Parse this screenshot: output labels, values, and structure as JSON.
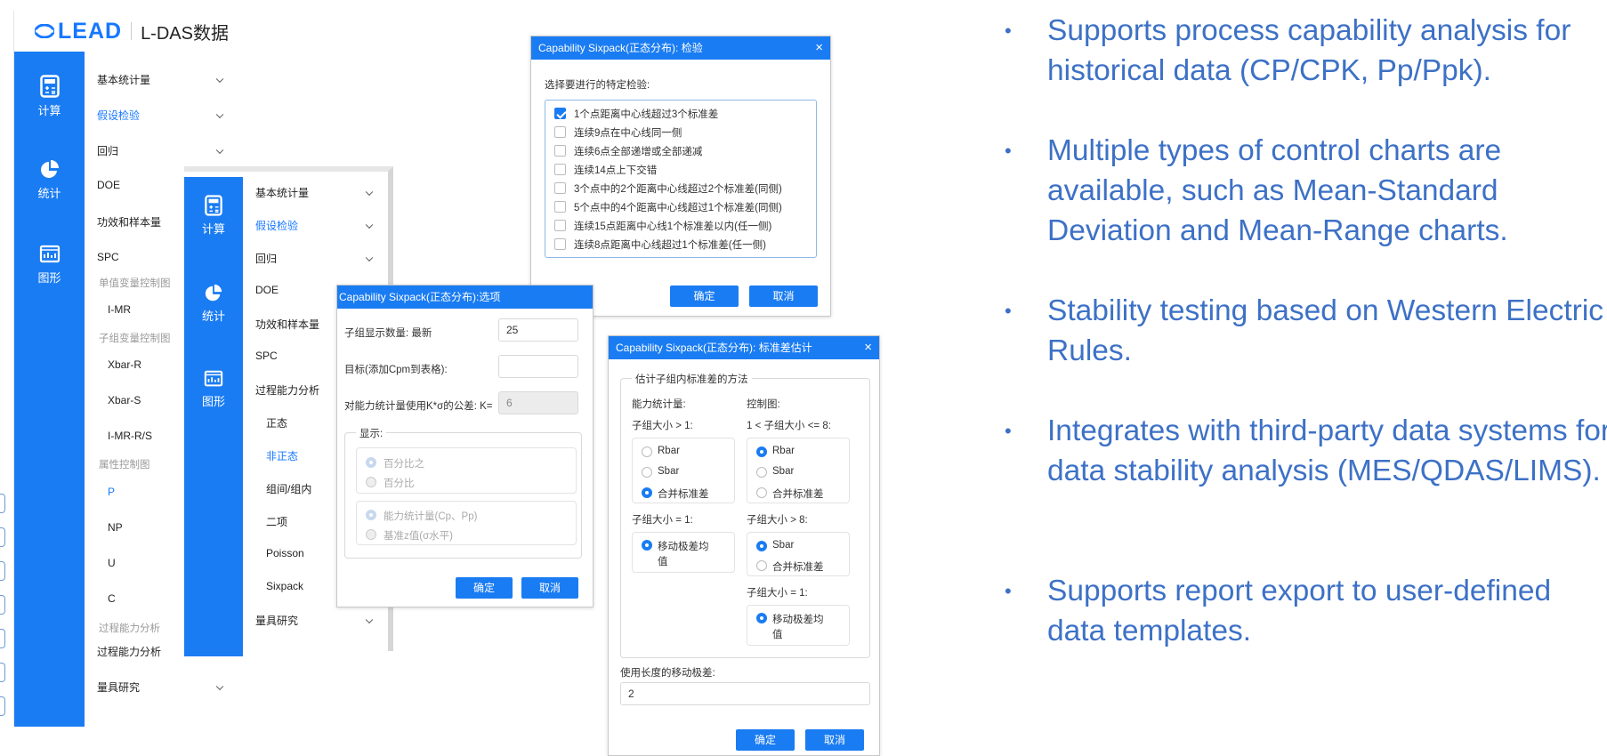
{
  "app": {
    "logo_text": "LEAD",
    "app_name": "L-DAS数据",
    "rail": [
      {
        "label": "计算",
        "icon": "calculator-icon"
      },
      {
        "label": "统计",
        "icon": "pie-chart-icon"
      },
      {
        "label": "图形",
        "icon": "chart-board-icon"
      }
    ],
    "menu1": {
      "basic_stats": "基本统计量",
      "hypothesis": "假设检验",
      "regression": "回归",
      "doe": "DOE",
      "power": "功效和样本量",
      "spc": "SPC",
      "group_single": "单值变量控制图",
      "imr": "I-MR",
      "group_subgroup": "子组变量控制图",
      "xbar_r": "Xbar-R",
      "xbar_s": "Xbar-S",
      "imr_rs": "I-MR-R/S",
      "group_attr": "属性控制图",
      "p": "P",
      "np": "NP",
      "u": "U",
      "c": "C",
      "group_capability": "过程能力分析",
      "capability": "过程能力分析",
      "gauge": "量具研究"
    },
    "menu2": {
      "basic_stats": "基本统计量",
      "hypothesis": "假设检验",
      "regression": "回归",
      "doe": "DOE",
      "power": "功效和样本量",
      "spc": "SPC",
      "capability": "过程能力分析",
      "normal": "正态",
      "nonnormal": "非正态",
      "between_within": "组间/组内",
      "binomial": "二项",
      "poisson": "Poisson",
      "sixpack": "Sixpack",
      "gauge": "量具研究"
    }
  },
  "dialog_tests": {
    "title": "Capability Sixpack(正态分布): 检验",
    "close": "×",
    "prompt": "选择要进行的特定检验:",
    "tests": [
      {
        "label": "1个点距离中心线超过3个标准差",
        "checked": true
      },
      {
        "label": "连续9点在中心线同一侧",
        "checked": false
      },
      {
        "label": "连续6点全部递增或全部递减",
        "checked": false
      },
      {
        "label": "连续14点上下交错",
        "checked": false
      },
      {
        "label": "3个点中的2个距离中心线超过2个标准差(同侧)",
        "checked": false
      },
      {
        "label": "5个点中的4个距离中心线超过1个标准差(同侧)",
        "checked": false
      },
      {
        "label": "连续15点距离中心线1个标准差以内(任一侧)",
        "checked": false
      },
      {
        "label": "连续8点距离中心线超过1个标准差(任一侧)",
        "checked": false
      }
    ],
    "ok": "确定",
    "cancel": "取消"
  },
  "dialog_options": {
    "title": "Capability Sixpack(正态分布):选项",
    "subgroups_label": "子组显示数量: 最新",
    "subgroups_value": "25",
    "target_label": "目标(添加Cpm到表格):",
    "target_value": "",
    "k_label": "对能力统计量使用K*σ的公差: K=",
    "k_value": "6",
    "display_legend": "显示:",
    "percent_ratio": "百分比之",
    "percent": "百分比",
    "cap_stats": "能力统计量(Cp、Pp)",
    "z_bench": "基准z值(σ水平)",
    "ok": "确定",
    "cancel": "取消"
  },
  "dialog_stddev": {
    "title": "Capability Sixpack(正态分布): 标准差估计",
    "close": "×",
    "legend": "估计子组内标准差的方法",
    "cap_stat_label": "能力统计量:",
    "control_label": "控制图:",
    "size_gt1": "子组大小 > 1:",
    "size_1_8": "1 < 子组大小 <= 8:",
    "rbar": "Rbar",
    "sbar": "Sbar",
    "pooled": "合并标准差",
    "size_eq1": "子组大小 = 1:",
    "size_gt8": "子组大小 > 8:",
    "moving_range": "移动极差均值",
    "moving_range_line1": "移动极差均",
    "moving_range_line2": "值",
    "size_eq1_b": "子组大小 = 1:",
    "ma_length_label": "使用长度的移动极差:",
    "ma_length_value": "2",
    "ok": "确定",
    "cancel": "取消"
  },
  "bullets": [
    "Supports process capability analysis for historical data (CP/CPK, Pp/Ppk).",
    "Multiple types of control charts are available, such as Mean-Standard Deviation and Mean-Range charts.",
    "Stability testing based on Western Electric Rules.",
    "Integrates with third-party data systems for data stability analysis (MES/QDAS/LIMS).",
    "Supports report export to user-defined data templates."
  ],
  "colors": {
    "primary": "#1a7cf2",
    "bullet_text": "#3d71c6"
  }
}
